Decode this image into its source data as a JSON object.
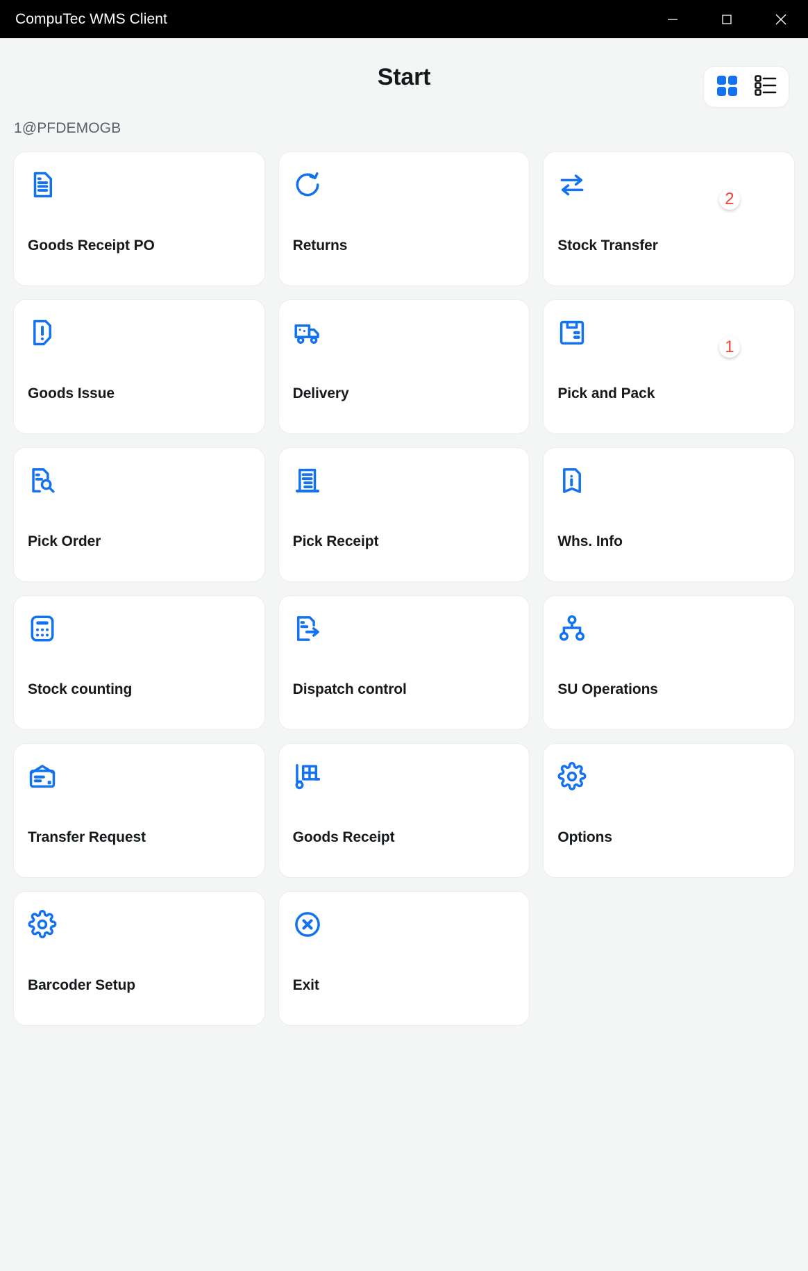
{
  "window": {
    "title": "CompuTec WMS Client",
    "controls": [
      {
        "name": "minimize-button",
        "icon": "minimize-icon"
      },
      {
        "name": "maximize-button",
        "icon": "maximize-icon"
      },
      {
        "name": "close-button",
        "icon": "close-icon"
      }
    ]
  },
  "header": {
    "title": "Start",
    "view_toggle": {
      "grid_label": "grid-view-icon",
      "list_label": "list-view-icon",
      "active": "grid"
    }
  },
  "session": {
    "label": "1@PFDEMOGB"
  },
  "colors": {
    "accent": "#1272ef",
    "badge_text": "#ef4035",
    "titlebar_bg": "#000000",
    "page_bg": "#f4f6f6",
    "tile_bg": "#ffffff",
    "text": "#15191c",
    "muted_text": "#57606a"
  },
  "tiles": [
    {
      "label": "Goods Receipt PO",
      "icon": "document-lines-icon",
      "badge": ""
    },
    {
      "label": "Returns",
      "icon": "refresh-icon",
      "badge": ""
    },
    {
      "label": "Stock Transfer",
      "icon": "transfer-arrows-icon",
      "badge": "2"
    },
    {
      "label": "Goods Issue",
      "icon": "document-alert-icon",
      "badge": ""
    },
    {
      "label": "Delivery",
      "icon": "truck-icon",
      "badge": ""
    },
    {
      "label": "Pick and Pack",
      "icon": "floppy-box-icon",
      "badge": "1"
    },
    {
      "label": "Pick Order",
      "icon": "document-search-icon",
      "badge": ""
    },
    {
      "label": "Pick Receipt",
      "icon": "receipt-icon",
      "badge": ""
    },
    {
      "label": "Whs. Info",
      "icon": "bookmark-info-icon",
      "badge": ""
    },
    {
      "label": "Stock counting",
      "icon": "calculator-icon",
      "badge": ""
    },
    {
      "label": "Dispatch control",
      "icon": "document-arrow-icon",
      "badge": ""
    },
    {
      "label": "SU Operations",
      "icon": "hierarchy-icon",
      "badge": ""
    },
    {
      "label": "Transfer Request",
      "icon": "envelope-card-icon",
      "badge": ""
    },
    {
      "label": "Goods Receipt",
      "icon": "hand-truck-icon",
      "badge": ""
    },
    {
      "label": "Options",
      "icon": "gear-icon",
      "badge": ""
    },
    {
      "label": "Barcoder Setup",
      "icon": "gear-icon",
      "badge": ""
    },
    {
      "label": "Exit",
      "icon": "close-circle-icon",
      "badge": ""
    }
  ]
}
